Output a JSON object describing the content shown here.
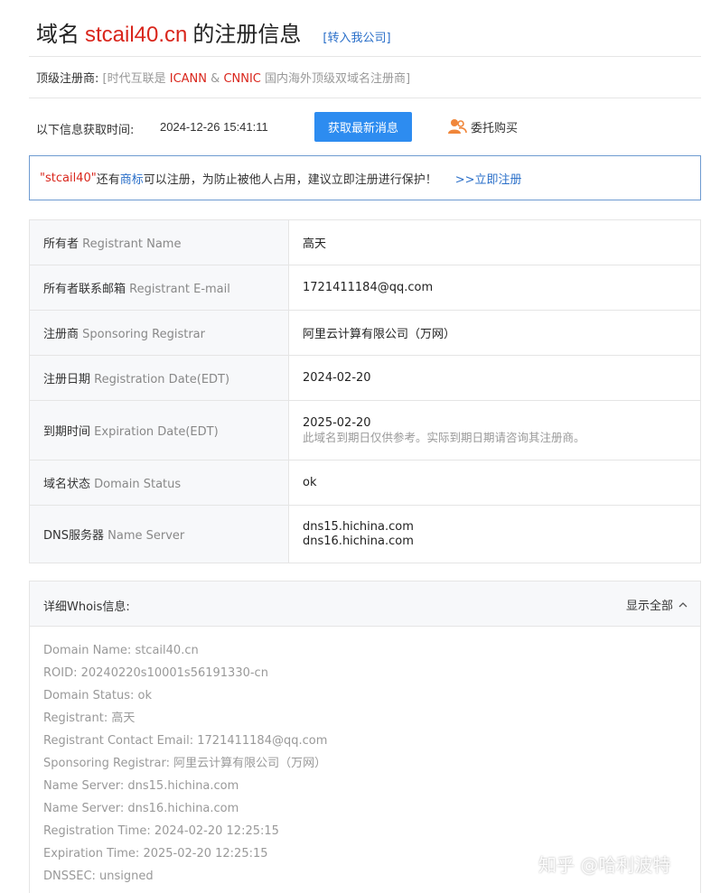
{
  "header": {
    "title_prefix": "域名",
    "domain": "stcail40.cn",
    "title_suffix": "的注册信息",
    "transfer_link": "[转入我公司]"
  },
  "registrar_line": {
    "label": "顶级注册商:",
    "p1": "[时代互联是",
    "icann": "ICANN",
    "amp": "&",
    "cnnic": "CNNIC",
    "p2": "国内海外顶级双域名注册商]"
  },
  "fetch": {
    "label": "以下信息获取时间:",
    "time": "2024-12-26 15:41:11",
    "button": "获取最新消息",
    "entrust": "委托购买"
  },
  "notice": {
    "name": "\"stcail40\"",
    "t1": "还有",
    "trademark": "商标",
    "t2": "可以注册，为防止被他人占用，建议立即注册进行保护！",
    "link": ">>立即注册"
  },
  "rows": [
    {
      "zh": "所有者",
      "en": "Registrant Name",
      "value": "高天"
    },
    {
      "zh": "所有者联系邮箱",
      "en": "Registrant E-mail",
      "value": "1721411184@qq.com"
    },
    {
      "zh": "注册商",
      "en": "Sponsoring Registrar",
      "value": "阿里云计算有限公司（万网）"
    },
    {
      "zh": "注册日期",
      "en": "Registration Date(EDT)",
      "value": "2024-02-20"
    },
    {
      "zh": "到期时间",
      "en": "Expiration Date(EDT)",
      "value": "2025-02-20",
      "hint": "此域名到期日仅供参考。实际到期日期请咨询其注册商。"
    },
    {
      "zh": "域名状态",
      "en": "Domain Status",
      "value": "ok"
    },
    {
      "zh": "DNS服务器",
      "en": "Name Server",
      "value": "dns15.hichina.com",
      "value2": "dns16.hichina.com"
    }
  ],
  "whois": {
    "title": "详细Whois信息:",
    "toggle": "显示全部",
    "lines": [
      "Domain Name: stcail40.cn",
      "ROID: 20240220s10001s56191330-cn",
      "Domain Status: ok",
      "Registrant: 高天",
      "Registrant Contact Email: 1721411184@qq.com",
      "Sponsoring Registrar: 阿里云计算有限公司（万网）",
      "Name Server: dns15.hichina.com",
      "Name Server: dns16.hichina.com",
      "Registration Time: 2024-02-20 12:25:15",
      "Expiration Time: 2025-02-20 12:25:15",
      "DNSSEC: unsigned"
    ]
  },
  "watermark": "知乎 @哈利波特",
  "colors": {
    "accent_red": "#d9261c",
    "link_blue": "#2a6fc9",
    "button_blue": "#2d8cf0",
    "entrust_orange": "#f0863a"
  },
  "icons": {
    "entrust": "user-group-icon",
    "toggle": "chevron-up-icon"
  }
}
